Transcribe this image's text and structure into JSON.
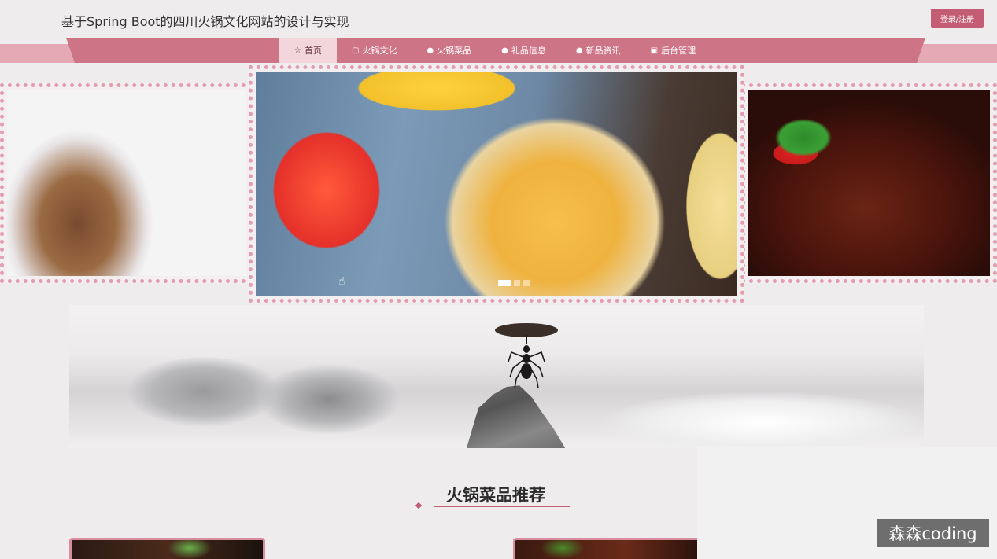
{
  "header": {
    "site_title": "基于Spring Boot的四川火锅文化网站的设计与实现",
    "login_label": "登录/注册"
  },
  "nav": {
    "items": [
      {
        "label": "首页",
        "icon": "star-icon",
        "active": true
      },
      {
        "label": "火锅文化",
        "icon": "bag-icon",
        "active": false
      },
      {
        "label": "火锅菜品",
        "icon": "info-circle-icon",
        "active": false
      },
      {
        "label": "礼品信息",
        "icon": "info-circle-icon",
        "active": false
      },
      {
        "label": "新品资讯",
        "icon": "info-circle-icon",
        "active": false
      },
      {
        "label": "后台管理",
        "icon": "briefcase-icon",
        "active": false
      }
    ]
  },
  "carousel": {
    "slide_count": 3,
    "active_index": 0
  },
  "section": {
    "title": "火锅菜品推荐"
  },
  "watermark": {
    "text": "森森coding"
  },
  "colors": {
    "accent": "#c45d74",
    "nav_bg": "#ce7487",
    "nav_active_bg": "#f2d6dc",
    "border_dots": "#e29db0"
  }
}
